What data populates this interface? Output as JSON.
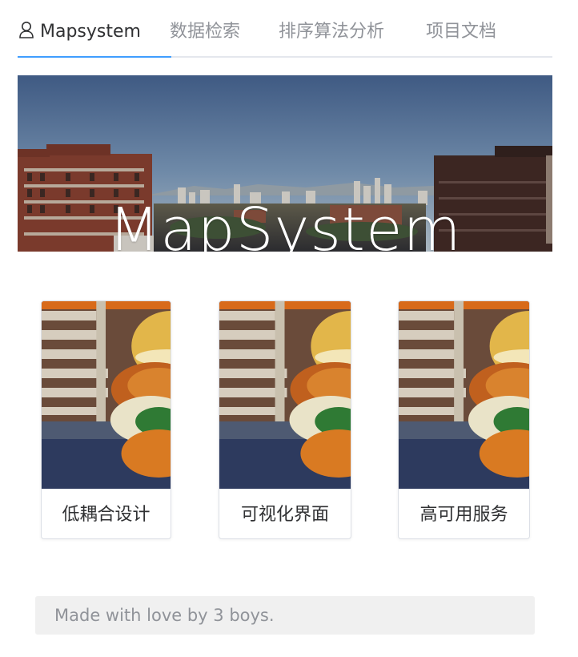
{
  "tabs": [
    {
      "label": "Mapsystem",
      "icon": "user-icon",
      "active": true
    },
    {
      "label": "数据检索",
      "active": false
    },
    {
      "label": "排序算法分析",
      "active": false
    },
    {
      "label": "项目文档",
      "active": false
    }
  ],
  "banner": {
    "title": "MapSystem"
  },
  "cards": [
    {
      "label": "低耦合设计"
    },
    {
      "label": "可视化界面"
    },
    {
      "label": "高可用服务"
    }
  ],
  "footer": {
    "text": "Made with love by 3 boys."
  },
  "colors": {
    "accent": "#409eff",
    "tab_inactive": "#909399",
    "tab_active": "#303133"
  }
}
